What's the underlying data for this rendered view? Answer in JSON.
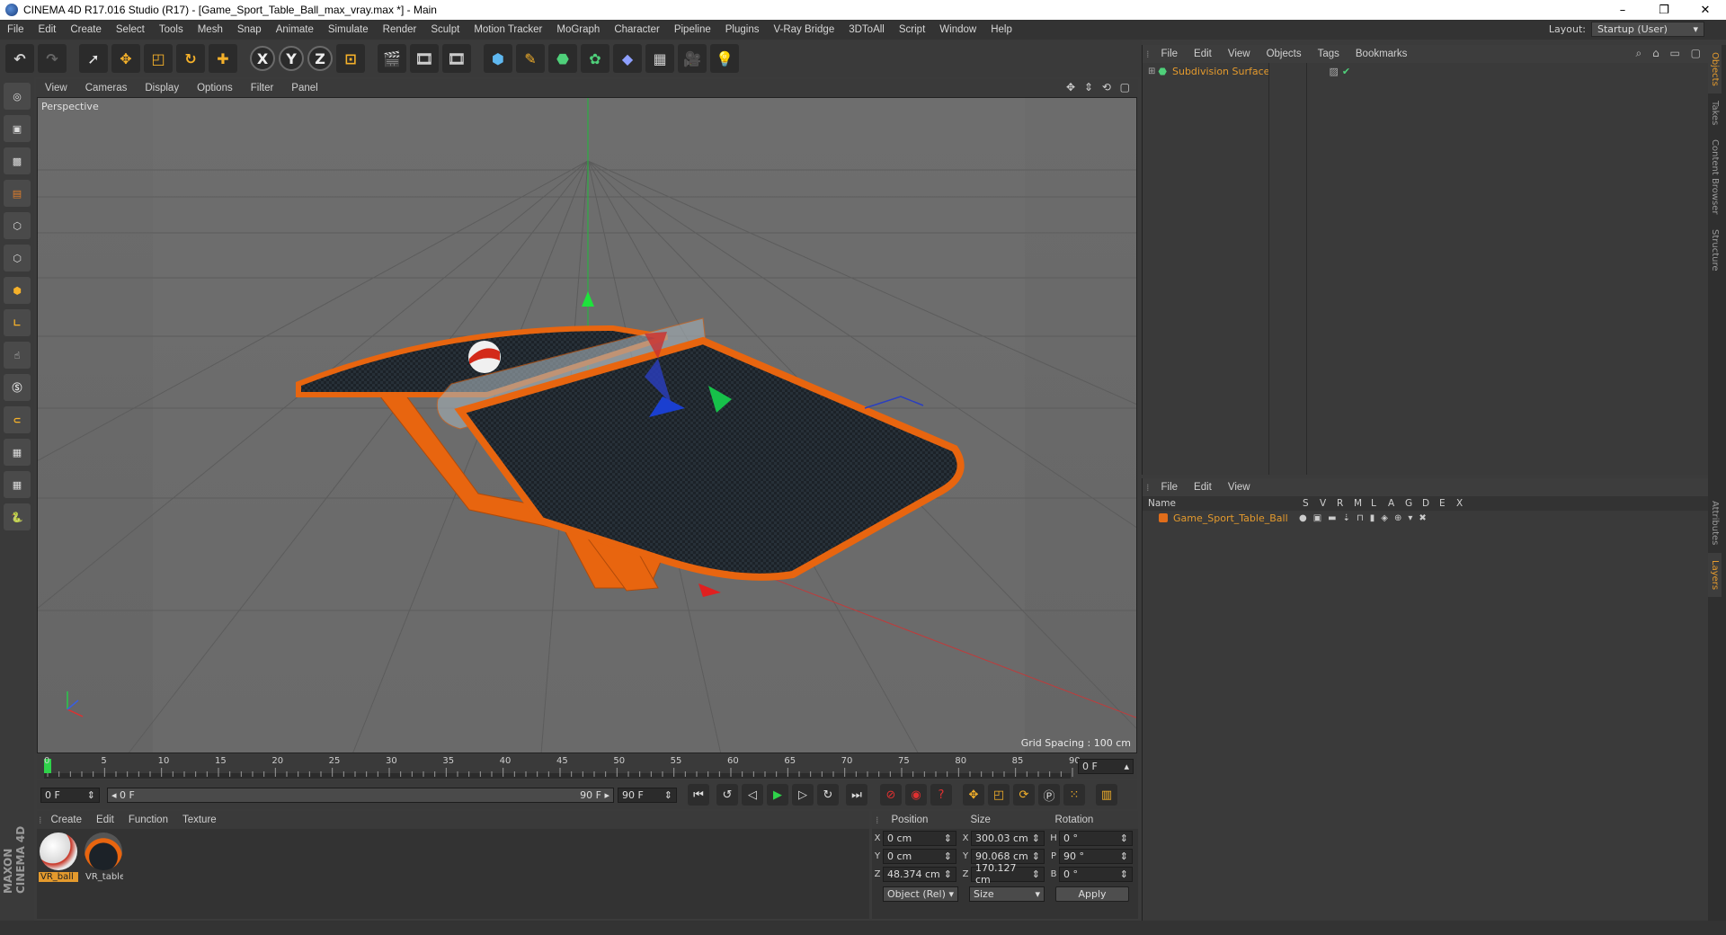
{
  "window": {
    "title": "CINEMA 4D R17.016 Studio (R17) - [Game_Sport_Table_Ball_max_vray.max *] - Main",
    "minimize": "–",
    "restore": "❐",
    "close": "✕"
  },
  "menu": [
    "File",
    "Edit",
    "Create",
    "Select",
    "Tools",
    "Mesh",
    "Snap",
    "Animate",
    "Simulate",
    "Render",
    "Sculpt",
    "Motion Tracker",
    "MoGraph",
    "Character",
    "Pipeline",
    "Plugins",
    "V-Ray Bridge",
    "3DToAll",
    "Script",
    "Window",
    "Help"
  ],
  "layout": {
    "label": "Layout:",
    "value": "Startup (User)"
  },
  "toolbar": {
    "axis_x": "X",
    "axis_y": "Y",
    "axis_z": "Z"
  },
  "viewport": {
    "menu": [
      "View",
      "Cameras",
      "Display",
      "Options",
      "Filter",
      "Panel"
    ],
    "label": "Perspective",
    "grid_spacing": "Grid Spacing : 100 cm"
  },
  "timeline": {
    "ticks": [
      "0",
      "5",
      "10",
      "15",
      "20",
      "25",
      "30",
      "35",
      "40",
      "45",
      "50",
      "55",
      "60",
      "65",
      "70",
      "75",
      "80",
      "85",
      "90"
    ],
    "current_frame": "0 F",
    "start_field": "0 F",
    "slider_left": "◂ 0 F",
    "slider_right": "90 F ▸",
    "end_field": "90 F"
  },
  "materials": {
    "menu": [
      "Create",
      "Edit",
      "Function",
      "Texture"
    ],
    "items": [
      {
        "label": "VR_ball"
      },
      {
        "label": "VR_table"
      }
    ]
  },
  "coords": {
    "headers": [
      "Position",
      "Size",
      "Rotation"
    ],
    "rows": [
      {
        "axis": "X",
        "pos": "0 cm",
        "size_axis": "X",
        "size": "300.03 cm",
        "rot_axis": "H",
        "rot": "0 °"
      },
      {
        "axis": "Y",
        "pos": "0 cm",
        "size_axis": "Y",
        "size": "90.068 cm",
        "rot_axis": "P",
        "rot": "90 °"
      },
      {
        "axis": "Z",
        "pos": "48.374 cm",
        "size_axis": "Z",
        "size": "170.127 cm",
        "rot_axis": "B",
        "rot": "0 °"
      }
    ],
    "mode": "Object (Rel)",
    "size_mode": "Size",
    "apply": "Apply"
  },
  "objects": {
    "menu": [
      "File",
      "Edit",
      "View",
      "Objects",
      "Tags",
      "Bookmarks"
    ],
    "items": [
      {
        "name": "Subdivision Surface"
      }
    ]
  },
  "layers": {
    "menu": [
      "File",
      "Edit",
      "View"
    ],
    "columns": [
      "Name",
      "S",
      "V",
      "R",
      "M",
      "L",
      "A",
      "G",
      "D",
      "E",
      "X"
    ],
    "items": [
      {
        "name": "Game_Sport_Table_Ball"
      }
    ]
  },
  "side_tabs": [
    "Objects",
    "Takes",
    "Content Browser",
    "Structure",
    "Attributes",
    "Layers"
  ],
  "brand": "MAXON CINEMA 4D",
  "colors": {
    "accent_orange": "#e06d1a",
    "object_name": "#e49a2d",
    "viewport_bg": "#6b6b6b"
  }
}
